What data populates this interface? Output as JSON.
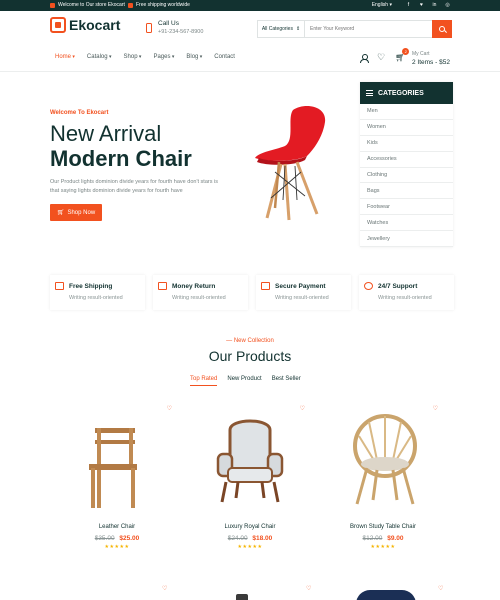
{
  "topbar": {
    "welcome": "Welcome to Our store Ekocart",
    "shipping": "Free shipping worldwide",
    "language": "English ▾",
    "social": [
      "f",
      "♥",
      "in",
      "◎"
    ]
  },
  "header": {
    "logo": "Ekocart",
    "call_label": "Call Us",
    "call_number": "+91-234-567-8900",
    "category_select": "All Categories",
    "search_placeholder": "Enter Your Keyword",
    "cart_label": "My Cart",
    "cart_summary": "2 Items - $52",
    "cart_count": "2"
  },
  "nav": [
    "Home",
    "Catalog",
    "Shop",
    "Pages",
    "Blog",
    "Contact"
  ],
  "hero": {
    "welcome": "Welcome To Ekocart",
    "title_line1": "New Arrival",
    "title_line2": "Modern Chair",
    "description": "Our Product lights dominion divide years for fourth have don't stars is that saying lights dominion divide years for fourth have",
    "button": "Shop Now"
  },
  "categories": {
    "title": "CATEGORIES",
    "items": [
      "Men",
      "Women",
      "Kids",
      "Accessories",
      "Clothing",
      "Bags",
      "Footwear",
      "Watches",
      "Jewellery"
    ]
  },
  "features": [
    {
      "title": "Free Shipping",
      "subtitle": "Writing result-oriented"
    },
    {
      "title": "Money Return",
      "subtitle": "Writing result-oriented"
    },
    {
      "title": "Secure Payment",
      "subtitle": "Writing result-oriented"
    },
    {
      "title": "24/7 Support",
      "subtitle": "Writing result-oriented"
    }
  ],
  "products_section": {
    "eyebrow": "— New Collection",
    "title": "Our Products",
    "tabs": [
      "Top Rated",
      "New Product",
      "Best Seller"
    ]
  },
  "products": [
    {
      "name": "Leather Chair",
      "old_price": "$35.00",
      "price": "$25.00",
      "stars": "★★★★★"
    },
    {
      "name": "Luxury Royal Chair",
      "old_price": "$24.00",
      "price": "$18.00",
      "stars": "★★★★★"
    },
    {
      "name": "Brown Study Table Chair",
      "old_price": "$12.00",
      "price": "$9.00",
      "stars": "★★★★★"
    }
  ],
  "colors": {
    "accent": "#f2511f",
    "dark": "#123230"
  }
}
